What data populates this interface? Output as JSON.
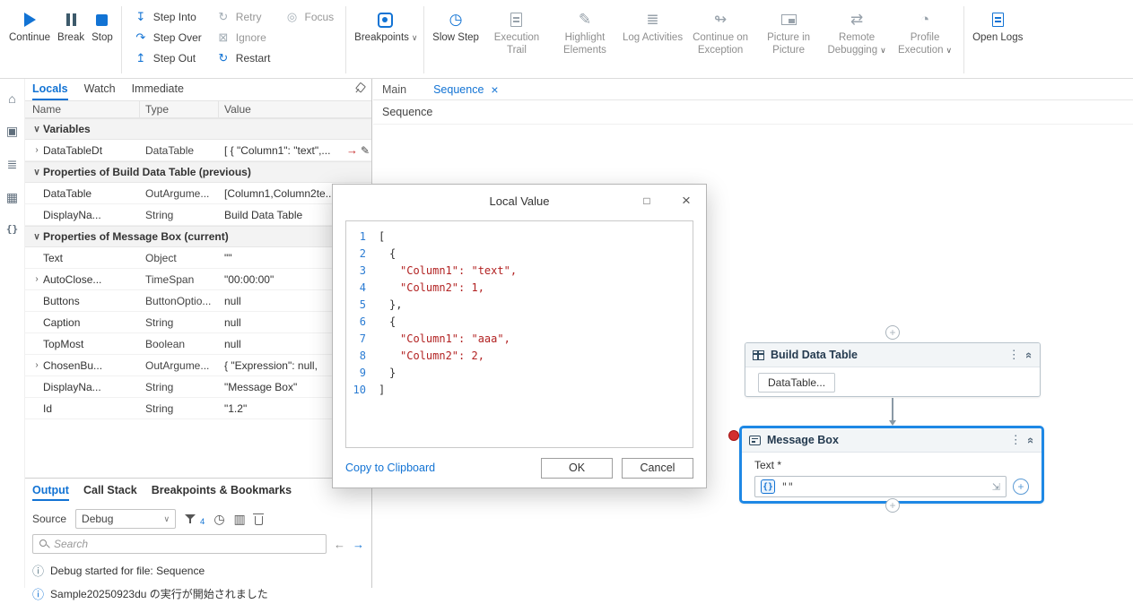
{
  "colors": {
    "accent": "#1273d4",
    "selection_border": "#1e88e5",
    "breakpoint": "#d32f2f",
    "code_string": "#b22222"
  },
  "icons": {
    "step_into": "↧",
    "step_over": "↷",
    "step_out": "↥",
    "retry": "↻",
    "ignore": "⊠",
    "restart": "↻",
    "focus": "◎",
    "slow_step": "◷",
    "highlight_elements": "✎",
    "log_activities": "≣",
    "continue_on_exception": "↬",
    "remote_debugging": "⇄",
    "profile_execution": "◔",
    "chevron_down": "∨",
    "dots": "⋮",
    "collapse": "«",
    "plus": "+",
    "info": "ⓘ",
    "close": "×",
    "maximize": "□",
    "back_arrow": "←",
    "forward_arrow": "→",
    "nav_arrow": "→",
    "pencil": "✎",
    "home": "⌂",
    "files": "▣",
    "layers": "≣",
    "package": "▦",
    "braces": "{}",
    "expand": "⇲",
    "clock": "◷",
    "columns": "▥"
  },
  "toolbar": {
    "continue": "Continue",
    "break": "Break",
    "stop": "Stop",
    "step_into": "Step Into",
    "step_over": "Step Over",
    "step_out": "Step Out",
    "retry": "Retry",
    "ignore": "Ignore",
    "restart": "Restart",
    "focus": "Focus",
    "breakpoints": "Breakpoints",
    "slow_step": "Slow Step",
    "execution_trail": "Execution Trail",
    "highlight_elements": "Highlight Elements",
    "log_activities": "Log Activities",
    "continue_on_exception": "Continue on Exception",
    "picture_in_picture": "Picture in Picture",
    "remote_debugging": "Remote Debugging",
    "profile_execution": "Profile Execution",
    "open_logs": "Open Logs"
  },
  "locals_panel": {
    "tabs": [
      "Locals",
      "Watch",
      "Immediate"
    ],
    "active_tab": "Locals",
    "columns": [
      "Name",
      "Type",
      "Value"
    ],
    "entries": [
      {
        "kind": "section",
        "exp": "∨",
        "name": "Variables"
      },
      {
        "kind": "row",
        "cls": "editable",
        "exp": "›",
        "name": "DataTableDt",
        "type": "DataTable",
        "value": "[ { \"Column1\": \"text\",..."
      },
      {
        "kind": "section",
        "exp": "∨",
        "name": "Properties of Build Data Table (previous)"
      },
      {
        "kind": "row",
        "exp": "",
        "name": "DataTable",
        "type": "OutArgume...",
        "value": "[Column1,Column2te..."
      },
      {
        "kind": "row",
        "exp": "",
        "name": "DisplayNa...",
        "type": "String",
        "value": "Build Data Table"
      },
      {
        "kind": "section",
        "exp": "∨",
        "name": "Properties of Message Box (current)"
      },
      {
        "kind": "row",
        "exp": "",
        "name": "Text",
        "type": "Object",
        "value": "\"\""
      },
      {
        "kind": "row",
        "exp": "›",
        "name": "AutoClose...",
        "type": "TimeSpan",
        "value": "\"00:00:00\""
      },
      {
        "kind": "row",
        "exp": "",
        "name": "Buttons",
        "type": "ButtonOptio...",
        "value": "null"
      },
      {
        "kind": "row",
        "exp": "",
        "name": "Caption",
        "type": "String",
        "value": "null"
      },
      {
        "kind": "row",
        "exp": "",
        "name": "TopMost",
        "type": "Boolean",
        "value": "null"
      },
      {
        "kind": "row",
        "exp": "›",
        "name": "ChosenBu...",
        "type": "OutArgume...",
        "value": "{ \"Expression\": null,"
      },
      {
        "kind": "row",
        "exp": "",
        "name": "DisplayNa...",
        "type": "String",
        "value": "\"Message Box\""
      },
      {
        "kind": "row",
        "exp": "",
        "name": "Id",
        "type": "String",
        "value": "\"1.2\""
      }
    ]
  },
  "output_panel": {
    "tabs": [
      "Output",
      "Call Stack",
      "Breakpoints & Bookmarks"
    ],
    "active_tab": "Output",
    "source_label": "Source",
    "source_value": "Debug",
    "filter_count": "4",
    "search_placeholder": "Search",
    "messages": [
      {
        "icon": "gray",
        "text": "Debug started for file: Sequence"
      },
      {
        "icon": "blue",
        "text": "Sample20250923du の実行が開始されました"
      }
    ]
  },
  "designer": {
    "tabs": [
      {
        "label": "Main",
        "active": false
      },
      {
        "label": "Sequence",
        "active": true,
        "closable": true
      }
    ],
    "breadcrumb": "Sequence",
    "build_data_table": {
      "title": "Build Data Table",
      "button": "DataTable..."
    },
    "message_box": {
      "title": "Message Box",
      "field_label": "Text *",
      "badge": "{}",
      "expression": "\"\""
    }
  },
  "dialog": {
    "title": "Local Value",
    "code_lines": [
      {
        "num": 1,
        "ind": "ind0",
        "color": "plain",
        "text": "["
      },
      {
        "num": 2,
        "ind": "ind1",
        "color": "plain",
        "text": "{"
      },
      {
        "num": 3,
        "ind": "ind2",
        "color": "red",
        "text": "\"Column1\": \"text\","
      },
      {
        "num": 4,
        "ind": "ind2",
        "color": "red",
        "text": "\"Column2\": 1,"
      },
      {
        "num": 5,
        "ind": "ind1",
        "color": "plain",
        "text": "},"
      },
      {
        "num": 6,
        "ind": "ind1",
        "color": "plain",
        "text": "{"
      },
      {
        "num": 7,
        "ind": "ind2",
        "color": "red",
        "text": "\"Column1\": \"aaa\","
      },
      {
        "num": 8,
        "ind": "ind2",
        "color": "red",
        "text": "\"Column2\": 2,"
      },
      {
        "num": 9,
        "ind": "ind1",
        "color": "plain",
        "text": "}"
      },
      {
        "num": 10,
        "ind": "ind0",
        "color": "plain",
        "text": "]"
      }
    ],
    "copy_link": "Copy to Clipboard",
    "ok": "OK",
    "cancel": "Cancel"
  }
}
